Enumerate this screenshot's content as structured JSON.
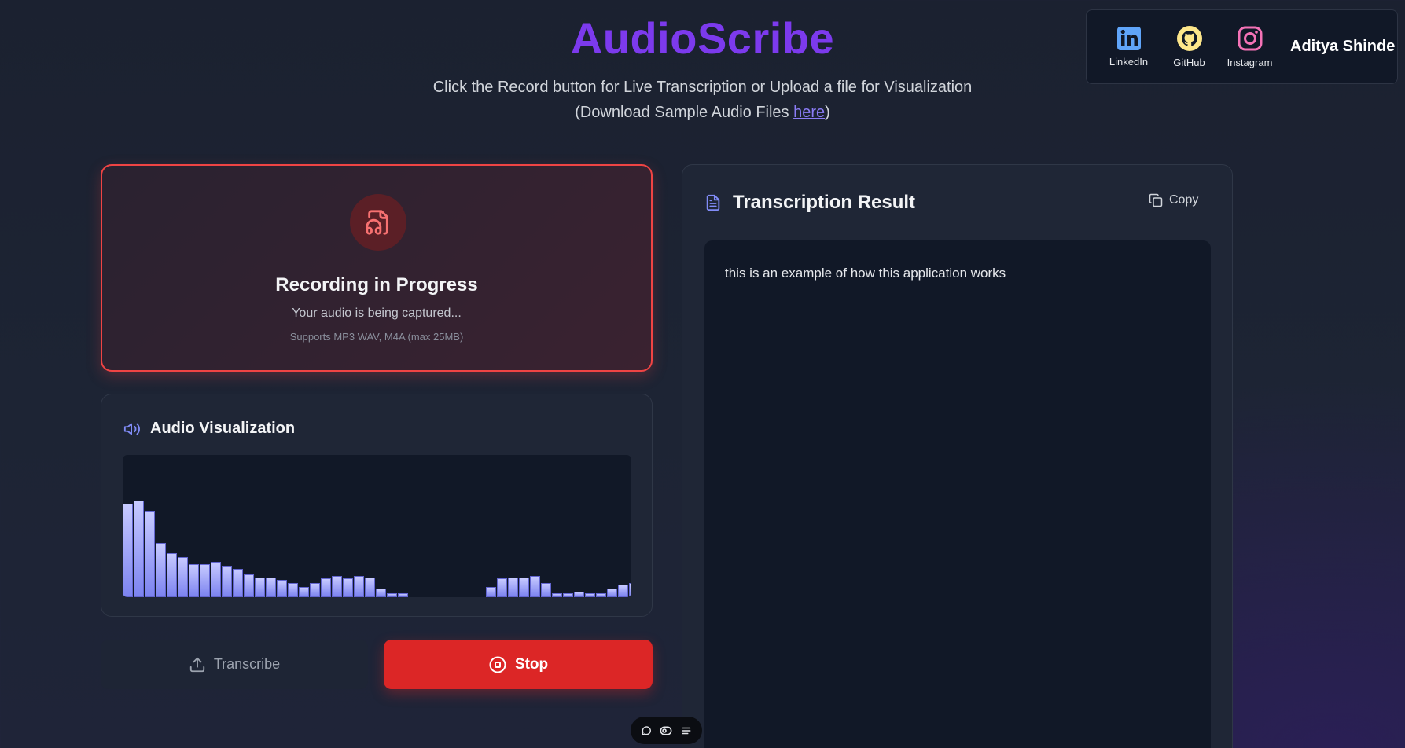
{
  "header": {
    "title": "AudioScribe",
    "subtitle_line1": "Click the Record button for Live Transcription or Upload a file for Visualization",
    "subtitle_prefix": "(Download Sample Audio Files ",
    "subtitle_link": "here",
    "subtitle_suffix": ")"
  },
  "social": {
    "linkedin": "LinkedIn",
    "github": "GitHub",
    "instagram": "Instagram",
    "name": "Aditya Shinde"
  },
  "recording": {
    "title": "Recording in Progress",
    "subtitle": "Your audio is being captured...",
    "note": "Supports MP3 WAV, M4A (max 25MB)"
  },
  "visualization": {
    "title": "Audio Visualization",
    "levels": [
      0.66,
      0.68,
      0.61,
      0.38,
      0.31,
      0.28,
      0.23,
      0.23,
      0.25,
      0.22,
      0.2,
      0.16,
      0.14,
      0.14,
      0.12,
      0.1,
      0.07,
      0.1,
      0.13,
      0.15,
      0.13,
      0.15,
      0.14,
      0.06,
      0.03,
      0.03,
      0.0,
      0.0,
      0.0,
      0.0,
      0.0,
      0.0,
      0.0,
      0.07,
      0.13,
      0.14,
      0.14,
      0.15,
      0.1,
      0.03,
      0.03,
      0.04,
      0.03,
      0.03,
      0.06,
      0.09,
      0.1
    ]
  },
  "actions": {
    "transcribe": "Transcribe",
    "stop": "Stop"
  },
  "result": {
    "title": "Transcription Result",
    "copy": "Copy",
    "text": "this is an example of how this application works"
  },
  "colors": {
    "accent": "#7c3aed",
    "recording_border": "#ef4444",
    "stop_button": "#dc2626",
    "bar_top": "#c7caff",
    "bar_bottom": "#7c83f0"
  }
}
